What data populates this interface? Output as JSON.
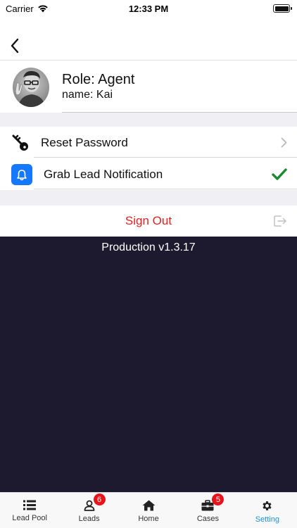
{
  "status_bar": {
    "carrier": "Carrier",
    "time": "12:33 PM"
  },
  "profile": {
    "role": "Role: Agent",
    "name": "name: Kai"
  },
  "settings": {
    "reset_password": "Reset Password",
    "grab_lead_notification": "Grab Lead Notification",
    "notification_enabled": true
  },
  "sign_out": {
    "label": "Sign Out",
    "color": "#e0211f"
  },
  "footer": {
    "version": "Production v1.3.17"
  },
  "tab_bar": {
    "active": "Setting",
    "tabs": [
      {
        "label": "Lead Pool",
        "icon": "list-icon",
        "badge": ""
      },
      {
        "label": "Leads",
        "icon": "person-icon",
        "badge": "6"
      },
      {
        "label": "Home",
        "icon": "home-icon",
        "badge": ""
      },
      {
        "label": "Cases",
        "icon": "briefcase-icon",
        "badge": "5"
      },
      {
        "label": "Setting",
        "icon": "gear-icon",
        "badge": ""
      }
    ]
  },
  "colors": {
    "accent": "#1e90d8",
    "dark_bg": "#1d1a2f",
    "check": "#1a8a2e",
    "bell_bg": "#1677ff",
    "badge": "#e8141c"
  }
}
